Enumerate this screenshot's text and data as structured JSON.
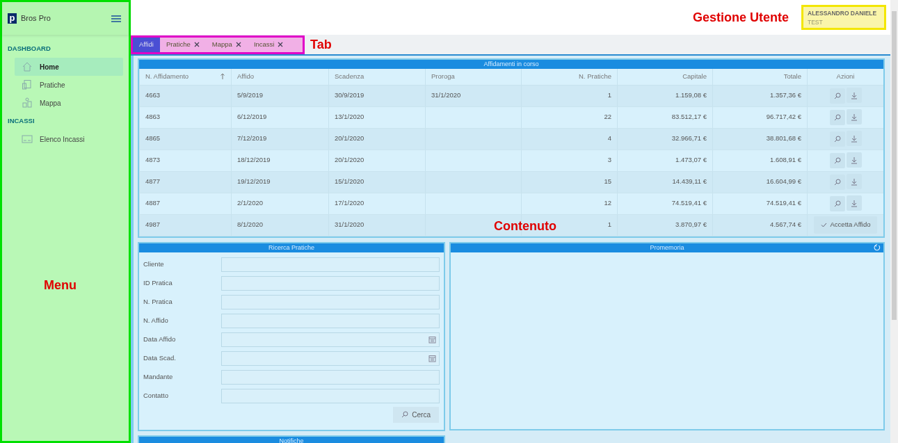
{
  "sidebar": {
    "brand_mark": "p",
    "brand": "Bros Pro",
    "annotation": "Menu",
    "sections": [
      {
        "title": "DASHBOARD",
        "items": [
          {
            "label": "Home",
            "selected": true
          },
          {
            "label": "Pratiche",
            "selected": false
          },
          {
            "label": "Mappa",
            "selected": false
          }
        ]
      },
      {
        "title": "INCASSI",
        "items": [
          {
            "label": "Elenco Incassi",
            "selected": false
          }
        ]
      }
    ]
  },
  "header": {
    "annotation": "Gestione Utente",
    "user": {
      "name": "ALESSANDRO DANIELE",
      "role": "TEST"
    }
  },
  "tabs": {
    "annotation": "Tab",
    "items": [
      {
        "label": "Affidi",
        "selected": true,
        "closable": false
      },
      {
        "label": "Pratiche",
        "selected": false,
        "closable": true
      },
      {
        "label": "Mappa",
        "selected": false,
        "closable": true
      },
      {
        "label": "Incassi",
        "selected": false,
        "closable": true
      }
    ]
  },
  "content_annotation": "Contenuto",
  "table": {
    "title": "Affidamenti in corso",
    "columns": [
      {
        "label": "N. Affidamento",
        "sort_ascending": true
      },
      {
        "label": "Affido"
      },
      {
        "label": "Scadenza"
      },
      {
        "label": "Proroga"
      },
      {
        "label": "N. Pratiche"
      },
      {
        "label": "Capitale"
      },
      {
        "label": "Totale"
      },
      {
        "label": "Azioni"
      }
    ],
    "rows": [
      {
        "cells": [
          "4663",
          "5/9/2019",
          "30/9/2019",
          "31/1/2020",
          "1",
          "1.159,08 €",
          "1.357,36 €"
        ],
        "action": {
          "kind": "icons"
        }
      },
      {
        "cells": [
          "4863",
          "6/12/2019",
          "13/1/2020",
          "",
          "22",
          "83.512,17 €",
          "96.717,42 €"
        ],
        "action": {
          "kind": "icons"
        }
      },
      {
        "cells": [
          "4865",
          "7/12/2019",
          "20/1/2020",
          "",
          "4",
          "32.966,71 €",
          "38.801,68 €"
        ],
        "action": {
          "kind": "icons"
        }
      },
      {
        "cells": [
          "4873",
          "18/12/2019",
          "20/1/2020",
          "",
          "3",
          "1.473,07 €",
          "1.608,91 €"
        ],
        "action": {
          "kind": "icons"
        }
      },
      {
        "cells": [
          "4877",
          "19/12/2019",
          "15/1/2020",
          "",
          "15",
          "14.439,11 €",
          "16.604,99 €"
        ],
        "action": {
          "kind": "icons"
        }
      },
      {
        "cells": [
          "4887",
          "2/1/2020",
          "17/1/2020",
          "",
          "12",
          "74.519,41 €",
          "74.519,41 €"
        ],
        "action": {
          "kind": "icons"
        }
      },
      {
        "cells": [
          "4987",
          "8/1/2020",
          "31/1/2020",
          "",
          "1",
          "3.870,97 €",
          "4.567,74 €"
        ],
        "action": {
          "kind": "accept",
          "label": "Accetta Affido"
        }
      }
    ]
  },
  "search": {
    "title": "Ricerca Pratiche",
    "fields": [
      {
        "label": "Cliente",
        "kind": "text"
      },
      {
        "label": "ID Pratica",
        "kind": "text"
      },
      {
        "label": "N. Pratica",
        "kind": "text"
      },
      {
        "label": "N. Affido",
        "kind": "text"
      },
      {
        "label": "Data Affido",
        "kind": "date"
      },
      {
        "label": "Data Scad.",
        "kind": "date"
      },
      {
        "label": "Mandante",
        "kind": "text"
      },
      {
        "label": "Contatto",
        "kind": "text"
      }
    ],
    "button": "Cerca"
  },
  "reminders": {
    "title": "Promemoria"
  },
  "notifications": {
    "title": "Notifiche"
  }
}
